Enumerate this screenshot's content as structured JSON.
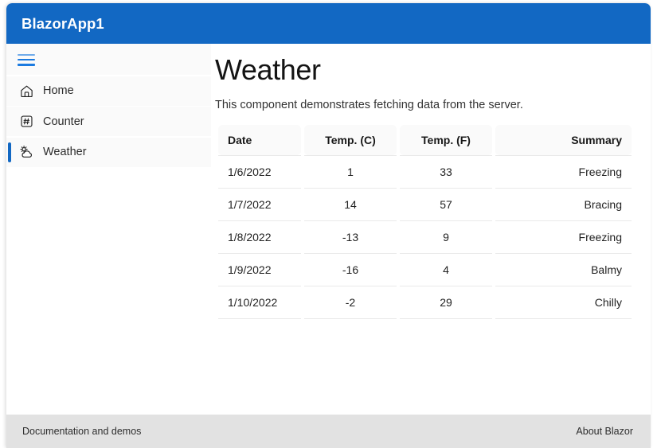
{
  "header": {
    "brand": "BlazorApp1",
    "brand_bg": "#1268c3"
  },
  "sidebar": {
    "toggle_icon": "hamburger-icon",
    "items": [
      {
        "label": "Home",
        "icon": "home-icon",
        "active": false
      },
      {
        "label": "Counter",
        "icon": "counter-icon",
        "active": false
      },
      {
        "label": "Weather",
        "icon": "weather-icon",
        "active": true
      }
    ]
  },
  "main": {
    "title": "Weather",
    "subtitle": "This component demonstrates fetching data from the server.",
    "table": {
      "columns": [
        "Date",
        "Temp. (C)",
        "Temp. (F)",
        "Summary"
      ],
      "rows": [
        {
          "date": "1/6/2022",
          "temp_c": "1",
          "temp_f": "33",
          "summary": "Freezing"
        },
        {
          "date": "1/7/2022",
          "temp_c": "14",
          "temp_f": "57",
          "summary": "Bracing"
        },
        {
          "date": "1/8/2022",
          "temp_c": "-13",
          "temp_f": "9",
          "summary": "Freezing"
        },
        {
          "date": "1/9/2022",
          "temp_c": "-16",
          "temp_f": "4",
          "summary": "Balmy"
        },
        {
          "date": "1/10/2022",
          "temp_c": "-2",
          "temp_f": "29",
          "summary": "Chilly"
        }
      ]
    }
  },
  "footer": {
    "left_link": "Documentation and demos",
    "right_link": "About Blazor"
  }
}
